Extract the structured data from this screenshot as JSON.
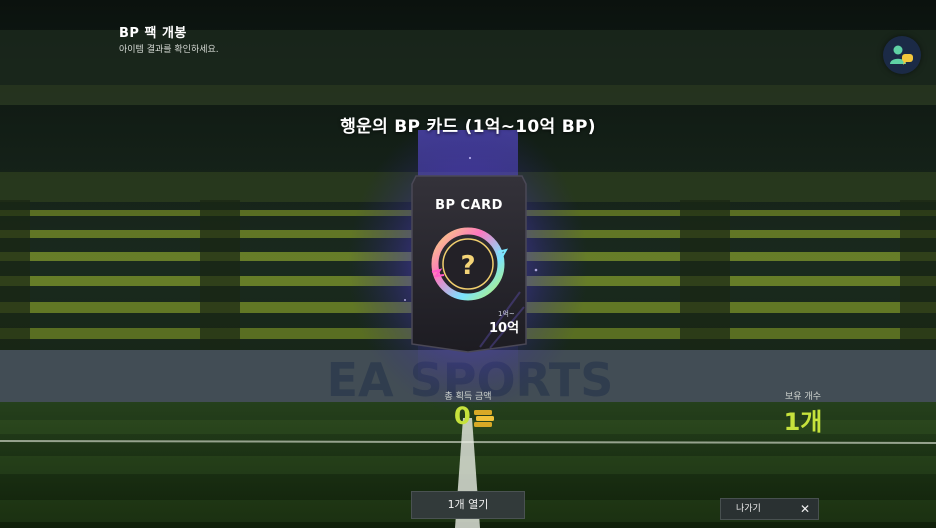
{
  "header": {
    "title": "BP 팩 개봉",
    "subtitle": "아이템 결과를 확인하세요."
  },
  "pack": {
    "title": "행운의 BP 카드 (1억~10억 BP)",
    "card_label": "BP CARD",
    "card_symbol": "?",
    "range_small": "1억~",
    "range_value": "10억"
  },
  "stats": {
    "total_label": "총 획득 금액",
    "total_value": "0",
    "owned_label": "보유 개수",
    "owned_value": "1개"
  },
  "buttons": {
    "open_label": "1개 열기",
    "exit_label": "나가기",
    "exit_icon": "✕"
  },
  "background_text": "EA SPORTS",
  "colors": {
    "accent": "#c6e23c",
    "purple_glow": "#6a4ff0",
    "avatar_bg": "#1b2a46"
  },
  "icons": {
    "avatar": "friends-chat-icon",
    "coin": "bp-coin-icon",
    "close": "close-icon"
  }
}
